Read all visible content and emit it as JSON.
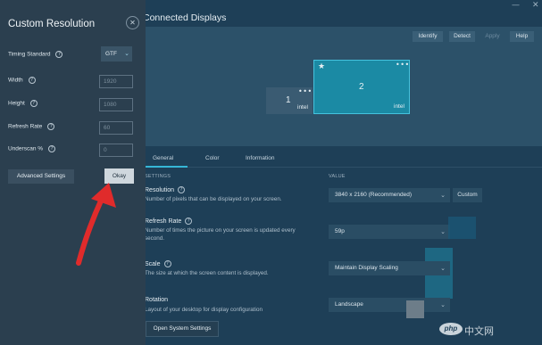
{
  "app": {
    "page_heading": "Connected Displays",
    "toolbar": {
      "identify": "Identify",
      "detect": "Detect",
      "apply": "Apply",
      "help": "Help"
    },
    "window_controls": {
      "minimize": "—",
      "close": "✕"
    },
    "monitors": [
      {
        "number": "1",
        "brand": "intel",
        "menu": "•••"
      },
      {
        "number": "2",
        "brand": "intel",
        "menu": "•••",
        "primary_icon": "★"
      }
    ],
    "tabs": [
      "General",
      "Color",
      "Information"
    ],
    "columns": {
      "settings": "SETTINGS",
      "value": "VALUE"
    },
    "settings": {
      "resolution": {
        "label": "Resolution",
        "desc": "Number of pixels that can be displayed on your screen.",
        "value": "3840 x 2160 (Recommended)",
        "custom": "Custom"
      },
      "refresh": {
        "label": "Refresh Rate",
        "desc": "Number of times the picture on your screen is updated every second.",
        "value": "59p"
      },
      "scale": {
        "label": "Scale",
        "desc": "The size at which the screen content is displayed.",
        "value": "Maintain Display Scaling"
      },
      "rotation": {
        "label": "Rotation",
        "desc": "Layout of your desktop for display configuration",
        "value": "Landscape"
      }
    },
    "open_system_settings": "Open System Settings",
    "watermark": {
      "logo": "php",
      "text": "中文网"
    }
  },
  "panel": {
    "title": "Custom Resolution",
    "close_icon": "✕",
    "help_glyph": "?",
    "timing_standard": {
      "label": "Timing Standard",
      "value": "GTF"
    },
    "width": {
      "label": "Width",
      "value": "1920"
    },
    "height": {
      "label": "Height",
      "value": "1080"
    },
    "refresh_rate": {
      "label": "Refresh Rate",
      "value": "60"
    },
    "underscan": {
      "label": "Underscan %",
      "value": "0"
    },
    "advanced_settings": "Advanced Settings",
    "okay": "Okay"
  },
  "colors": {
    "annotation_arrow": "#e02b2b",
    "accent": "#36b7d7"
  }
}
